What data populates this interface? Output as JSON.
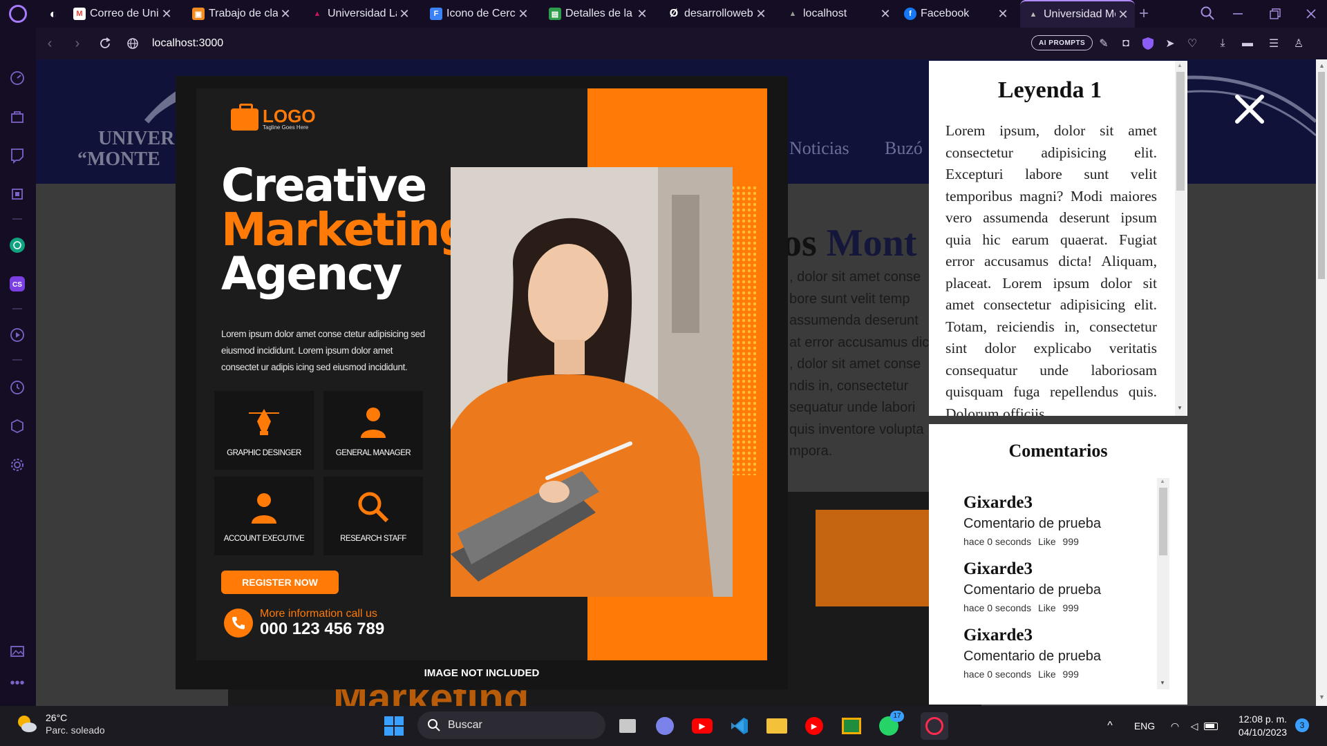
{
  "browser": {
    "tabs": [
      {
        "label": "",
        "fav_color": "#ffffff",
        "fav_glyph": "◐"
      },
      {
        "label": "Correo de Univ",
        "fav_color": "#ea4335",
        "fav_glyph": "M"
      },
      {
        "label": "Trabajo de clase",
        "fav_color": "#f28b20",
        "fav_glyph": "▣"
      },
      {
        "label": "Universidad La",
        "fav_color": "#c2185b",
        "fav_glyph": "▲"
      },
      {
        "label": "Icono de Cerca",
        "fav_color": "#3b82f6",
        "fav_glyph": "F"
      },
      {
        "label": "Detalles de la ta",
        "fav_color": "#2e9d4a",
        "fav_glyph": "▤"
      },
      {
        "label": "desarrolloweb.c",
        "fav_color": "#ffffff",
        "fav_glyph": "Ø"
      },
      {
        "label": "localhost",
        "fav_color": "#888888",
        "fav_glyph": "▲"
      },
      {
        "label": "Facebook",
        "fav_color": "#1877f2",
        "fav_glyph": "f"
      },
      {
        "label": "Universidad Mo",
        "fav_color": "#999999",
        "fav_glyph": "▲"
      }
    ],
    "url": "localhost:3000",
    "ai_prompts_label": "AI PROMPTS",
    "tab_close_glyph": "✕",
    "new_tab_glyph": "+"
  },
  "site": {
    "logo_line1": "UNIVER",
    "logo_line2": "“MONTE",
    "nav": [
      "Noticias",
      "Buzó"
    ],
    "heading_part1": "os ",
    "heading_part2": "Mont",
    "paragraph_lines": [
      ", dolor sit amet conse",
      "bore sunt velit temp",
      "assumenda deserunt",
      "at error accusamus dic",
      ", dolor sit amet conse",
      "ndis in, consectetur",
      "sequatur unde labori",
      "quis inventore volupta",
      "mpora."
    ],
    "background_text": "Marketing"
  },
  "flyer": {
    "logo_text": "LOGO",
    "logo_tagline": "Tagline Goes Here",
    "headline_1": "Creative",
    "headline_2": "Marketing",
    "headline_3": "Agency",
    "description": "Lorem ipsum dolor amet conse ctetur adipisicing sed eiusmod incididunt. Lorem ipsum dolor amet consectet ur adipis icing sed eiusmod incididunt.",
    "roles": [
      "GRAPHIC DESINGER",
      "GENERAL MANAGER",
      "ACCOUNT EXECUTIVE",
      "RESEARCH STAFF"
    ],
    "register_label": "REGISTER NOW",
    "call_label": "More information call us",
    "phone": "000 123 456 789",
    "image_note": "IMAGE NOT INCLUDED"
  },
  "legend": {
    "title": "Leyenda 1",
    "text": "Lorem ipsum, dolor sit amet consectetur adipisicing elit. Excepturi labore sunt velit temporibus magni? Modi maiores vero assumenda deserunt ipsum quia hic earum quaerat. Fugiat error accusamus dicta! Aliquam, placeat. Lorem ipsum dolor sit amet consectetur adipisicing elit. Totam, reiciendis in, consectetur sint dolor explicabo veritatis consequatur unde laboriosam quisquam fuga repellendus quis. Dolorum officiis."
  },
  "comments": {
    "title": "Comentarios",
    "items": [
      {
        "author": "Gixarde3",
        "text": "Comentario de prueba",
        "time": "hace 0 seconds",
        "like_label": "Like",
        "likes": "999"
      },
      {
        "author": "Gixarde3",
        "text": "Comentario de prueba",
        "time": "hace 0 seconds",
        "like_label": "Like",
        "likes": "999"
      },
      {
        "author": "Gixarde3",
        "text": "Comentario de prueba",
        "time": "hace 0 seconds",
        "like_label": "Like",
        "likes": "999"
      }
    ]
  },
  "taskbar": {
    "temperature": "26°C",
    "condition": "Parc. soleado",
    "search_label": "Buscar",
    "language": "ENG",
    "time": "12:08 p. m.",
    "date": "04/10/2023",
    "notification_count": "3",
    "whatsapp_badge": "17"
  },
  "colors": {
    "accent": "#ff7a06",
    "browser_accent": "#b18cff",
    "site_header": "#10123a"
  }
}
